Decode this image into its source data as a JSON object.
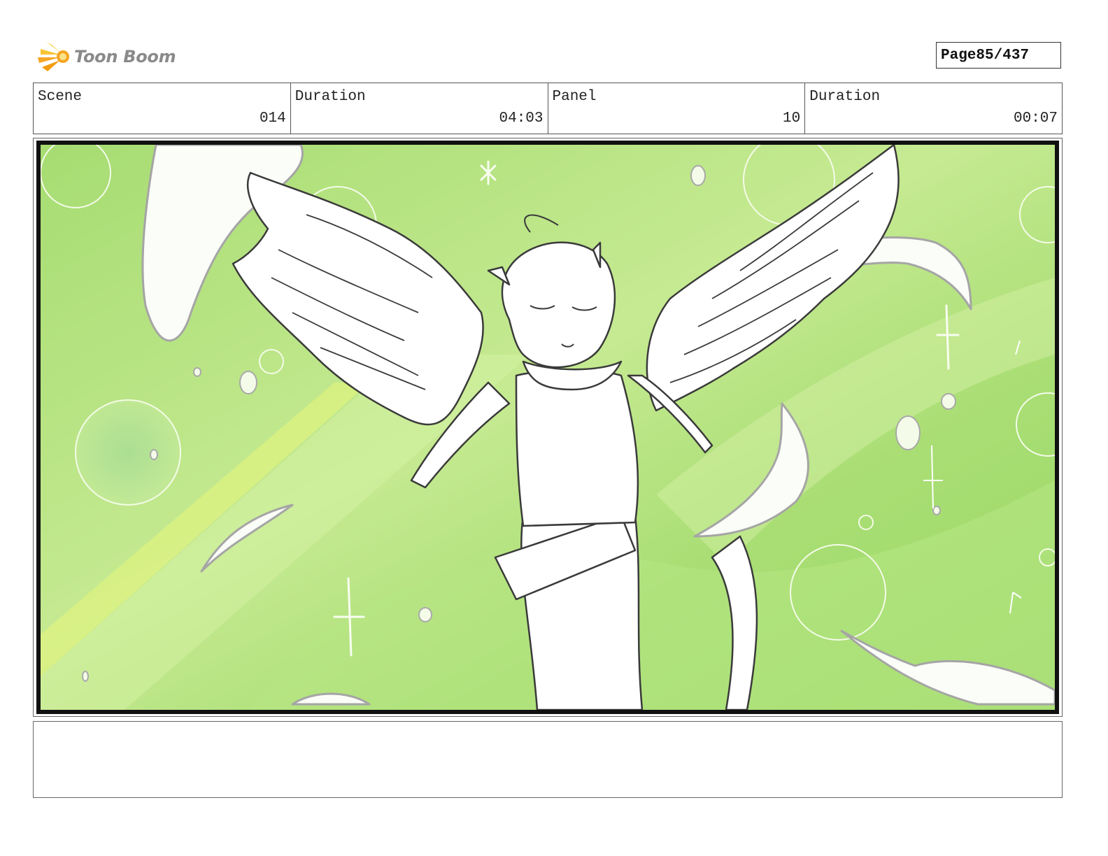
{
  "header": {
    "logo_text": "Toon Boom",
    "page_label": "Page",
    "page_number": "85/437"
  },
  "info": {
    "scene_label": "Scene",
    "scene_value": "014",
    "scene_duration_label": "Duration",
    "scene_duration_value": "04:03",
    "panel_label": "Panel",
    "panel_value": "10",
    "panel_duration_label": "Duration",
    "panel_duration_value": "00:07"
  },
  "notes": {
    "text": ""
  },
  "colors": {
    "logo_orange": "#f5a623",
    "background_green": "#b4e37a",
    "sketch_line": "#333333"
  },
  "icons": {
    "logo": "starburst-swoosh-icon"
  }
}
